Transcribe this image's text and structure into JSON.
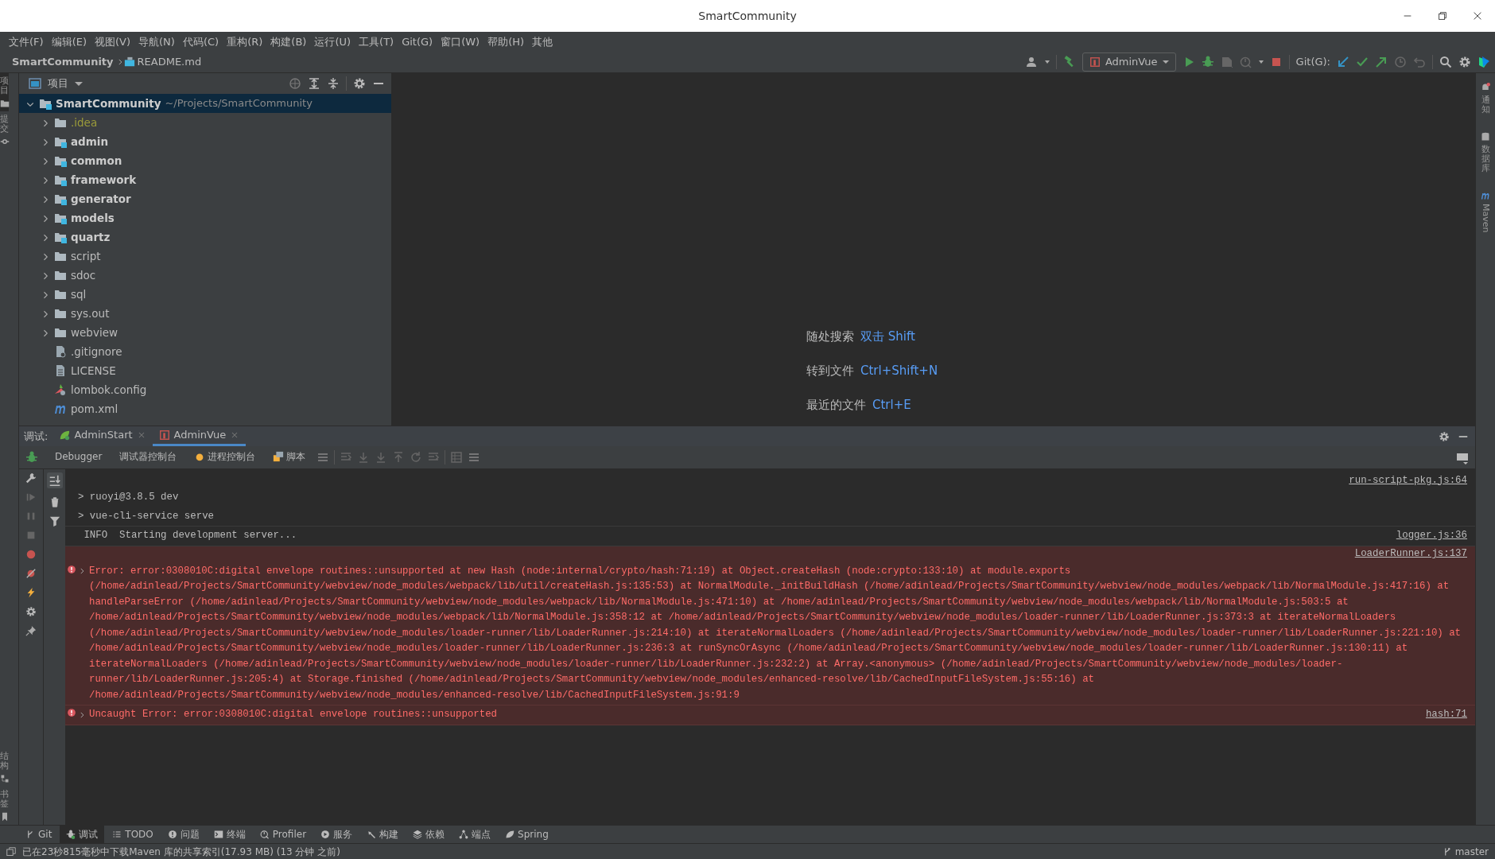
{
  "window": {
    "title": "SmartCommunity"
  },
  "menu": [
    "文件(F)",
    "编辑(E)",
    "视图(V)",
    "导航(N)",
    "代码(C)",
    "重构(R)",
    "构建(B)",
    "运行(U)",
    "工具(T)",
    "Git(G)",
    "窗口(W)",
    "帮助(H)",
    "其他"
  ],
  "breadcrumb": [
    {
      "label": "SmartCommunity",
      "kind": "project"
    },
    {
      "label": "README.md",
      "kind": "markdown"
    }
  ],
  "toolbar": {
    "run_config": "AdminVue",
    "git_label": "Git(G):"
  },
  "left_strip": {
    "top": [
      {
        "label": "项目",
        "selected": true
      },
      {
        "label": "提交",
        "selected": false
      }
    ],
    "bottom": [
      {
        "label": "结构",
        "selected": false
      },
      {
        "label": "书签",
        "selected": false
      }
    ]
  },
  "right_strip": [
    {
      "label": "通知",
      "kind": "bell"
    },
    {
      "label": "数据库",
      "kind": "database"
    },
    {
      "label": "Maven",
      "kind": "maven"
    }
  ],
  "project_panel": {
    "title": "项目",
    "tree": [
      {
        "label": "SmartCommunity",
        "path": "~/Projects/SmartCommunity",
        "kind": "module",
        "expanded": true,
        "selected": true,
        "children": [
          {
            "label": ".idea",
            "kind": "dotfolder",
            "expanded": false,
            "selected": false
          },
          {
            "label": "admin",
            "kind": "module",
            "expanded": false,
            "selected": false
          },
          {
            "label": "common",
            "kind": "module",
            "expanded": false,
            "selected": false
          },
          {
            "label": "framework",
            "kind": "module",
            "expanded": false,
            "selected": false
          },
          {
            "label": "generator",
            "kind": "module",
            "expanded": false,
            "selected": false
          },
          {
            "label": "models",
            "kind": "module",
            "expanded": false,
            "selected": false
          },
          {
            "label": "quartz",
            "kind": "module",
            "expanded": false,
            "selected": false
          },
          {
            "label": "script",
            "kind": "folder",
            "expanded": false,
            "selected": false
          },
          {
            "label": "sdoc",
            "kind": "folder",
            "expanded": false,
            "selected": false
          },
          {
            "label": "sql",
            "kind": "folder",
            "expanded": false,
            "selected": false
          },
          {
            "label": "sys.out",
            "kind": "folder",
            "expanded": false,
            "selected": false
          },
          {
            "label": "webview",
            "kind": "folder",
            "expanded": false,
            "selected": false
          },
          {
            "label": ".gitignore",
            "kind": "gitignore",
            "selected": false
          },
          {
            "label": "LICENSE",
            "kind": "text",
            "selected": false
          },
          {
            "label": "lombok.config",
            "kind": "config",
            "selected": false
          },
          {
            "label": "pom.xml",
            "kind": "maven",
            "selected": false
          }
        ]
      }
    ]
  },
  "editor_hints": [
    {
      "label": "随处搜索",
      "shortcut": "双击 Shift"
    },
    {
      "label": "转到文件",
      "shortcut": "Ctrl+Shift+N"
    },
    {
      "label": "最近的文件",
      "shortcut": "Ctrl+E"
    }
  ],
  "debug_panel": {
    "label": "调试:",
    "tabs": [
      {
        "label": "AdminStart",
        "kind": "spring",
        "selected": false
      },
      {
        "label": "AdminVue",
        "kind": "npm",
        "selected": true
      }
    ],
    "subtabs": [
      {
        "label": "Debugger",
        "kind": "plain",
        "selected": false
      },
      {
        "label": "调试器控制台",
        "kind": "plain",
        "selected": false
      },
      {
        "label": "进程控制台",
        "kind": "process",
        "selected": false
      },
      {
        "label": "脚本",
        "kind": "script",
        "selected": false
      }
    ],
    "console": [
      {
        "kind": "log",
        "source": "run-script-pkg.js:64",
        "source_above": true,
        "lines": [
          "> ruoyi@3.8.5 dev",
          "> vue-cli-service serve"
        ]
      },
      {
        "kind": "info",
        "source": "logger.js:36",
        "source_above": false,
        "lines": [
          " INFO  Starting development server..."
        ]
      },
      {
        "kind": "error",
        "source": "LoaderRunner.js:137",
        "source_above": true,
        "expanded": false,
        "lines": [
          "Error: error:0308010C:digital envelope routines::unsupported at new Hash (node:internal/crypto/hash:71:19) at Object.createHash (node:crypto:133:10) at module.exports (/home/adinlead/Projects/SmartCommunity/webview/node_modules/webpack/lib/util/createHash.js:135:53) at NormalModule._initBuildHash (/home/adinlead/Projects/SmartCommunity/webview/node_modules/webpack/lib/NormalModule.js:417:16) at handleParseError (/home/adinlead/Projects/SmartCommunity/webview/node_modules/webpack/lib/NormalModule.js:471:10) at /home/adinlead/Projects/SmartCommunity/webview/node_modules/webpack/lib/NormalModule.js:503:5 at /home/adinlead/Projects/SmartCommunity/webview/node_modules/webpack/lib/NormalModule.js:358:12 at /home/adinlead/Projects/SmartCommunity/webview/node_modules/loader-runner/lib/LoaderRunner.js:373:3 at iterateNormalLoaders (/home/adinlead/Projects/SmartCommunity/webview/node_modules/loader-runner/lib/LoaderRunner.js:214:10) at iterateNormalLoaders (/home/adinlead/Projects/SmartCommunity/webview/node_modules/loader-runner/lib/LoaderRunner.js:221:10) at /home/adinlead/Projects/SmartCommunity/webview/node_modules/loader-runner/lib/LoaderRunner.js:236:3 at runSyncOrAsync (/home/adinlead/Projects/SmartCommunity/webview/node_modules/loader-runner/lib/LoaderRunner.js:130:11) at iterateNormalLoaders (/home/adinlead/Projects/SmartCommunity/webview/node_modules/loader-runner/lib/LoaderRunner.js:232:2) at Array.<anonymous> (/home/adinlead/Projects/SmartCommunity/webview/node_modules/loader-runner/lib/LoaderRunner.js:205:4) at Storage.finished (/home/adinlead/Projects/SmartCommunity/webview/node_modules/enhanced-resolve/lib/CachedInputFileSystem.js:55:16) at /home/adinlead/Projects/SmartCommunity/webview/node_modules/enhanced-resolve/lib/CachedInputFileSystem.js:91:9"
        ]
      },
      {
        "kind": "error",
        "source": "hash:71",
        "source_above": false,
        "expanded": false,
        "lines": [
          "Uncaught Error: error:0308010C:digital envelope routines::unsupported"
        ]
      }
    ]
  },
  "tool_windows": [
    {
      "label": "Git",
      "kind": "git",
      "selected": false
    },
    {
      "label": "调试",
      "kind": "debug",
      "selected": true
    },
    {
      "label": "TODO",
      "kind": "list",
      "selected": false
    },
    {
      "label": "问题",
      "kind": "problem",
      "selected": false
    },
    {
      "label": "终端",
      "kind": "terminal",
      "selected": false
    },
    {
      "label": "Profiler",
      "kind": "profiler",
      "selected": false
    },
    {
      "label": "服务",
      "kind": "services",
      "selected": false
    },
    {
      "label": "构建",
      "kind": "build",
      "selected": false
    },
    {
      "label": "依赖",
      "kind": "layers",
      "selected": false
    },
    {
      "label": "端点",
      "kind": "endpoints",
      "selected": false
    },
    {
      "label": "Spring",
      "kind": "spring",
      "selected": false
    }
  ],
  "status_bar": {
    "message": "已在23秒815毫秒中下载Maven 库的共享索引(17.93 MB) (13 分钟 之前)",
    "branch": "master"
  }
}
